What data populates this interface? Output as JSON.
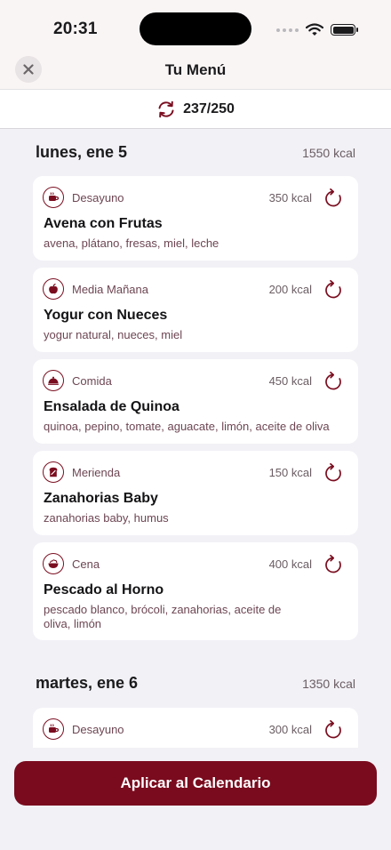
{
  "status_bar": {
    "time": "20:31"
  },
  "nav": {
    "title": "Tu Menú",
    "close_icon": "xmark-icon"
  },
  "swaps": {
    "count": "237/250",
    "icon": "swap-arrows-icon"
  },
  "days": [
    {
      "title": "lunes, ene 5",
      "total_kcal": "1550 kcal",
      "meals": [
        {
          "type": "Desayuno",
          "kcal": "350 kcal",
          "name": "Avena con Frutas",
          "ingredients": "avena, plátano, fresas, miel, leche",
          "icon": "coffee-cup-icon"
        },
        {
          "type": "Media Mañana",
          "kcal": "200 kcal",
          "name": "Yogur con Nueces",
          "ingredients": "yogur natural, nueces, miel",
          "icon": "apple-icon"
        },
        {
          "type": "Comida",
          "kcal": "450 kcal",
          "name": "Ensalada de Quinoa",
          "ingredients": "quinoa, pepino, tomate, aguacate, limón, aceite de oliva",
          "icon": "cloche-icon"
        },
        {
          "type": "Merienda",
          "kcal": "150 kcal",
          "name": "Zanahorias Baby",
          "ingredients": "zanahorias baby, humus",
          "icon": "toast-icon"
        },
        {
          "type": "Cena",
          "kcal": "400 kcal",
          "name": "Pescado al Horno",
          "ingredients": "pescado blanco, brócoli, zanahorias, aceite de oliva, limón",
          "icon": "bowl-icon"
        }
      ]
    },
    {
      "title": "martes, ene 6",
      "total_kcal": "1350 kcal",
      "meals": [
        {
          "type": "Desayuno",
          "kcal": "300 kcal",
          "icon": "coffee-cup-icon"
        }
      ]
    }
  ],
  "apply_button": {
    "label": "Aplicar al Calendario"
  },
  "colors": {
    "accent": "#7a0b1e",
    "background": "#f2f1f6",
    "card": "#ffffff",
    "secondary_text": "#6d4653"
  }
}
